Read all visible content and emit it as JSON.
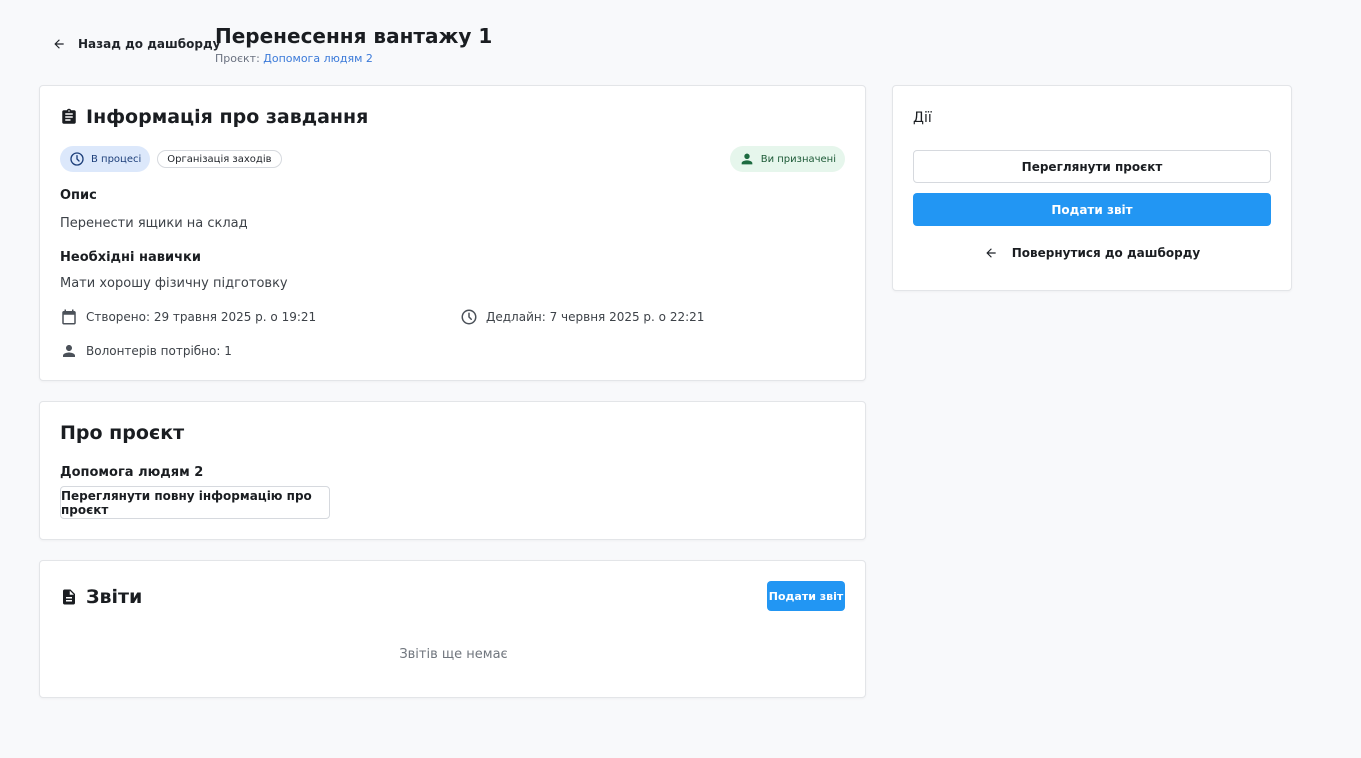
{
  "header": {
    "back_label": "Назад до дашборду",
    "title": "Перенесення вантажу 1",
    "project_prefix": "Проєкт:",
    "project_link": "Допомога людям 2"
  },
  "task_info": {
    "title": "Інформація про завдання",
    "status_chip": "В процесі",
    "category_chip": "Організація заходів",
    "assigned_chip": "Ви призначені",
    "description_label": "Опис",
    "description": "Перенести ящики на склад",
    "skills_label": "Необхідні навички",
    "skills": "Мати хорошу фізичну підготовку",
    "created": "Створено: 29 травня 2025 р. о 19:21",
    "deadline": "Дедлайн: 7 червня 2025 р. о 22:21",
    "volunteers": "Волонтерів потрібно: 1"
  },
  "about_project": {
    "title": "Про проєкт",
    "project_name": "Допомога людям 2",
    "view_full_button": "Переглянути повну інформацію про проєкт"
  },
  "reports": {
    "title": "Звіти",
    "submit_button": "Подати звіт",
    "empty_text": "Звітів ще немає"
  },
  "actions": {
    "title": "Дії",
    "view_project_button": "Переглянути проєкт",
    "submit_report_button": "Подати звіт",
    "back_button": "Повернутися до дашборду"
  },
  "colors": {
    "primary": "#2296f3",
    "link": "#3b7ad9",
    "status_bg": "#dce8fb",
    "assigned_bg": "#e6f6ec"
  },
  "icons": [
    "arrow-left-icon",
    "clipboard-icon",
    "clock-icon",
    "person-icon",
    "calendar-icon",
    "document-icon"
  ]
}
